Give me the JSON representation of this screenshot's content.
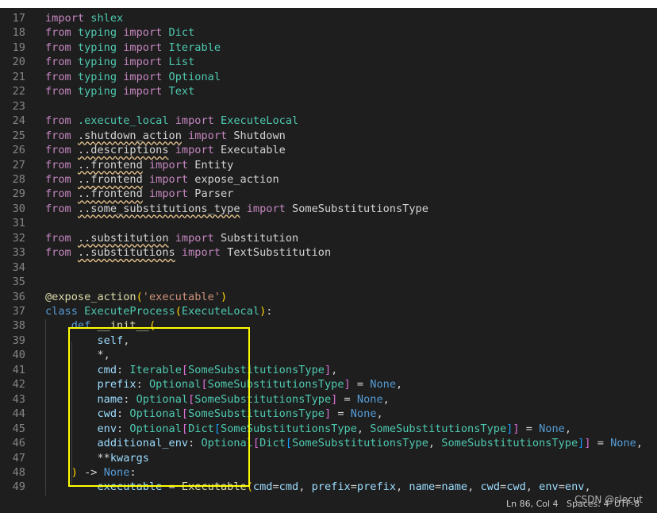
{
  "lines": [
    {
      "n": "17",
      "tokens": [
        [
          "ctl",
          "import"
        ],
        [
          "txt",
          " "
        ],
        [
          "mod",
          "shlex"
        ]
      ]
    },
    {
      "n": "18",
      "tokens": [
        [
          "ctl",
          "from"
        ],
        [
          "txt",
          " "
        ],
        [
          "mod",
          "typing"
        ],
        [
          "txt",
          " "
        ],
        [
          "ctl",
          "import"
        ],
        [
          "txt",
          " "
        ],
        [
          "ty",
          "Dict"
        ]
      ]
    },
    {
      "n": "19",
      "tokens": [
        [
          "ctl",
          "from"
        ],
        [
          "txt",
          " "
        ],
        [
          "mod",
          "typing"
        ],
        [
          "txt",
          " "
        ],
        [
          "ctl",
          "import"
        ],
        [
          "txt",
          " "
        ],
        [
          "ty",
          "Iterable"
        ]
      ]
    },
    {
      "n": "20",
      "tokens": [
        [
          "ctl",
          "from"
        ],
        [
          "txt",
          " "
        ],
        [
          "mod",
          "typing"
        ],
        [
          "txt",
          " "
        ],
        [
          "ctl",
          "import"
        ],
        [
          "txt",
          " "
        ],
        [
          "ty",
          "List"
        ]
      ]
    },
    {
      "n": "21",
      "tokens": [
        [
          "ctl",
          "from"
        ],
        [
          "txt",
          " "
        ],
        [
          "mod",
          "typing"
        ],
        [
          "txt",
          " "
        ],
        [
          "ctl",
          "import"
        ],
        [
          "txt",
          " "
        ],
        [
          "ty",
          "Optional"
        ]
      ]
    },
    {
      "n": "22",
      "tokens": [
        [
          "ctl",
          "from"
        ],
        [
          "txt",
          " "
        ],
        [
          "mod",
          "typing"
        ],
        [
          "txt",
          " "
        ],
        [
          "ctl",
          "import"
        ],
        [
          "txt",
          " "
        ],
        [
          "ty",
          "Text"
        ]
      ]
    },
    {
      "n": "23",
      "tokens": []
    },
    {
      "n": "24",
      "tokens": [
        [
          "ctl",
          "from"
        ],
        [
          "txt",
          " "
        ],
        [
          "mod",
          ".execute_local"
        ],
        [
          "txt",
          " "
        ],
        [
          "ctl",
          "import"
        ],
        [
          "txt",
          " "
        ],
        [
          "ty",
          "ExecuteLocal"
        ]
      ]
    },
    {
      "n": "25",
      "tokens": [
        [
          "ctl",
          "from"
        ],
        [
          "txt",
          " "
        ],
        [
          "txt wavy",
          ".shutdown_action"
        ],
        [
          "txt",
          " "
        ],
        [
          "ctl",
          "import"
        ],
        [
          "txt",
          " Shutdown"
        ]
      ]
    },
    {
      "n": "26",
      "tokens": [
        [
          "ctl",
          "from"
        ],
        [
          "txt",
          " "
        ],
        [
          "txt wavy",
          "..descriptions"
        ],
        [
          "txt",
          " "
        ],
        [
          "ctl",
          "import"
        ],
        [
          "txt",
          " Executable"
        ]
      ]
    },
    {
      "n": "27",
      "tokens": [
        [
          "ctl",
          "from"
        ],
        [
          "txt",
          " "
        ],
        [
          "txt wavy",
          "..frontend"
        ],
        [
          "txt",
          " "
        ],
        [
          "ctl",
          "import"
        ],
        [
          "txt",
          " Entity"
        ]
      ]
    },
    {
      "n": "28",
      "tokens": [
        [
          "ctl",
          "from"
        ],
        [
          "txt",
          " "
        ],
        [
          "txt wavy",
          "..frontend"
        ],
        [
          "txt",
          " "
        ],
        [
          "ctl",
          "import"
        ],
        [
          "txt",
          " expose_action"
        ]
      ]
    },
    {
      "n": "29",
      "tokens": [
        [
          "ctl",
          "from"
        ],
        [
          "txt",
          " "
        ],
        [
          "txt wavy",
          "..frontend"
        ],
        [
          "txt",
          " "
        ],
        [
          "ctl",
          "import"
        ],
        [
          "txt",
          " Parser"
        ]
      ]
    },
    {
      "n": "30",
      "tokens": [
        [
          "ctl",
          "from"
        ],
        [
          "txt",
          " "
        ],
        [
          "txt wavy",
          "..some_substitutions_type"
        ],
        [
          "txt",
          " "
        ],
        [
          "ctl",
          "import"
        ],
        [
          "txt",
          " SomeSubstitutionsType"
        ]
      ]
    },
    {
      "n": "31",
      "tokens": []
    },
    {
      "n": "32",
      "tokens": [
        [
          "ctl",
          "from"
        ],
        [
          "txt",
          " "
        ],
        [
          "txt wavy",
          "..substitution"
        ],
        [
          "txt",
          " "
        ],
        [
          "ctl",
          "import"
        ],
        [
          "txt",
          " Substitution"
        ]
      ]
    },
    {
      "n": "33",
      "tokens": [
        [
          "ctl",
          "from"
        ],
        [
          "txt",
          " "
        ],
        [
          "txt wavy",
          "..substitutions"
        ],
        [
          "txt",
          " "
        ],
        [
          "ctl",
          "import"
        ],
        [
          "txt",
          " TextSubstitution"
        ]
      ]
    },
    {
      "n": "34",
      "tokens": []
    },
    {
      "n": "35",
      "tokens": []
    },
    {
      "n": "36",
      "tokens": [
        [
          "fn",
          "@expose_action"
        ],
        [
          "br1",
          "("
        ],
        [
          "str",
          "'executable'"
        ],
        [
          "br1",
          ")"
        ]
      ]
    },
    {
      "n": "37",
      "tokens": [
        [
          "kw",
          "class"
        ],
        [
          "txt",
          " "
        ],
        [
          "ty",
          "ExecuteProcess"
        ],
        [
          "br1",
          "("
        ],
        [
          "ty",
          "ExecuteLocal"
        ],
        [
          "br1",
          ")"
        ],
        [
          "pu",
          ":"
        ]
      ]
    },
    {
      "n": "38",
      "tokens": [
        [
          "txt",
          "    "
        ],
        [
          "kw",
          "def"
        ],
        [
          "txt",
          " "
        ],
        [
          "fn",
          "__init__"
        ],
        [
          "br1",
          "("
        ]
      ]
    },
    {
      "n": "39",
      "tokens": [
        [
          "txt",
          "        "
        ],
        [
          "var",
          "self"
        ],
        [
          "pu",
          ","
        ]
      ]
    },
    {
      "n": "40",
      "tokens": [
        [
          "txt",
          "        "
        ],
        [
          "pu",
          "*,"
        ]
      ]
    },
    {
      "n": "41",
      "tokens": [
        [
          "txt",
          "        "
        ],
        [
          "var",
          "cmd"
        ],
        [
          "pu",
          ": "
        ],
        [
          "ty",
          "Iterable"
        ],
        [
          "br2",
          "["
        ],
        [
          "ty",
          "SomeSubstitutionsType"
        ],
        [
          "br2",
          "]"
        ],
        [
          "pu",
          ","
        ]
      ]
    },
    {
      "n": "42",
      "tokens": [
        [
          "txt",
          "        "
        ],
        [
          "var",
          "prefix"
        ],
        [
          "pu",
          ": "
        ],
        [
          "ty",
          "Optional"
        ],
        [
          "br2",
          "["
        ],
        [
          "ty",
          "SomeSubstitutionsType"
        ],
        [
          "br2",
          "]"
        ],
        [
          "pu",
          " = "
        ],
        [
          "kw",
          "None"
        ],
        [
          "pu",
          ","
        ]
      ]
    },
    {
      "n": "43",
      "tokens": [
        [
          "txt",
          "        "
        ],
        [
          "var",
          "name"
        ],
        [
          "pu",
          ": "
        ],
        [
          "ty",
          "Optional"
        ],
        [
          "br2",
          "["
        ],
        [
          "ty",
          "SomeSubstitutionsType"
        ],
        [
          "br2",
          "]"
        ],
        [
          "pu",
          " = "
        ],
        [
          "kw",
          "None"
        ],
        [
          "pu",
          ","
        ]
      ]
    },
    {
      "n": "44",
      "tokens": [
        [
          "txt",
          "        "
        ],
        [
          "var",
          "cwd"
        ],
        [
          "pu",
          ": "
        ],
        [
          "ty",
          "Optional"
        ],
        [
          "br2",
          "["
        ],
        [
          "ty",
          "SomeSubstitutionsType"
        ],
        [
          "br2",
          "]"
        ],
        [
          "pu",
          " = "
        ],
        [
          "kw",
          "None"
        ],
        [
          "pu",
          ","
        ]
      ]
    },
    {
      "n": "45",
      "tokens": [
        [
          "txt",
          "        "
        ],
        [
          "var",
          "env"
        ],
        [
          "pu",
          ": "
        ],
        [
          "ty",
          "Optional"
        ],
        [
          "br2",
          "["
        ],
        [
          "ty",
          "Dict"
        ],
        [
          "br3",
          "["
        ],
        [
          "ty",
          "SomeSubstitutionsType"
        ],
        [
          "pu",
          ", "
        ],
        [
          "ty",
          "SomeSubstitutionsType"
        ],
        [
          "br3",
          "]"
        ],
        [
          "br2",
          "]"
        ],
        [
          "pu",
          " = "
        ],
        [
          "kw",
          "None"
        ],
        [
          "pu",
          ","
        ]
      ]
    },
    {
      "n": "46",
      "tokens": [
        [
          "txt",
          "        "
        ],
        [
          "var",
          "additional_env"
        ],
        [
          "pu",
          ": "
        ],
        [
          "ty",
          "Optional"
        ],
        [
          "br2",
          "["
        ],
        [
          "ty",
          "Dict"
        ],
        [
          "br3",
          "["
        ],
        [
          "ty",
          "SomeSubstitutionsType"
        ],
        [
          "pu",
          ", "
        ],
        [
          "ty",
          "SomeSubstitutionsType"
        ],
        [
          "br3",
          "]"
        ],
        [
          "br2",
          "]"
        ],
        [
          "pu",
          " = "
        ],
        [
          "kw",
          "None"
        ],
        [
          "pu",
          ","
        ]
      ]
    },
    {
      "n": "47",
      "tokens": [
        [
          "txt",
          "        "
        ],
        [
          "pu",
          "**"
        ],
        [
          "var",
          "kwargs"
        ]
      ]
    },
    {
      "n": "48",
      "tokens": [
        [
          "txt",
          "    "
        ],
        [
          "br1",
          ")"
        ],
        [
          "pu",
          " -> "
        ],
        [
          "kw",
          "None"
        ],
        [
          "pu",
          ":"
        ]
      ]
    },
    {
      "n": "49",
      "tokens": [
        [
          "txt",
          "        "
        ],
        [
          "var",
          "executable"
        ],
        [
          "pu",
          " = "
        ],
        [
          "fn",
          "Executable"
        ],
        [
          "br1",
          "("
        ],
        [
          "var",
          "cmd"
        ],
        [
          "pu",
          "="
        ],
        [
          "var",
          "cmd"
        ],
        [
          "pu",
          ", "
        ],
        [
          "var",
          "prefix"
        ],
        [
          "pu",
          "="
        ],
        [
          "var",
          "prefix"
        ],
        [
          "pu",
          ", "
        ],
        [
          "var",
          "name"
        ],
        [
          "pu",
          "="
        ],
        [
          "var",
          "name"
        ],
        [
          "pu",
          ", "
        ],
        [
          "var",
          "cwd"
        ],
        [
          "pu",
          "="
        ],
        [
          "var",
          "cwd"
        ],
        [
          "pu",
          ", "
        ],
        [
          "var",
          "env"
        ],
        [
          "pu",
          "="
        ],
        [
          "var",
          "env"
        ],
        [
          "pu",
          ","
        ]
      ]
    }
  ],
  "status": {
    "cursor": "Ln 86, Col 4",
    "spaces": "Spaces: 4",
    "encoding": "UTF-8"
  },
  "watermark": "CSDN @slecut",
  "colors": {
    "background": "#1e1e1e",
    "highlight_box": "#ffff00"
  }
}
